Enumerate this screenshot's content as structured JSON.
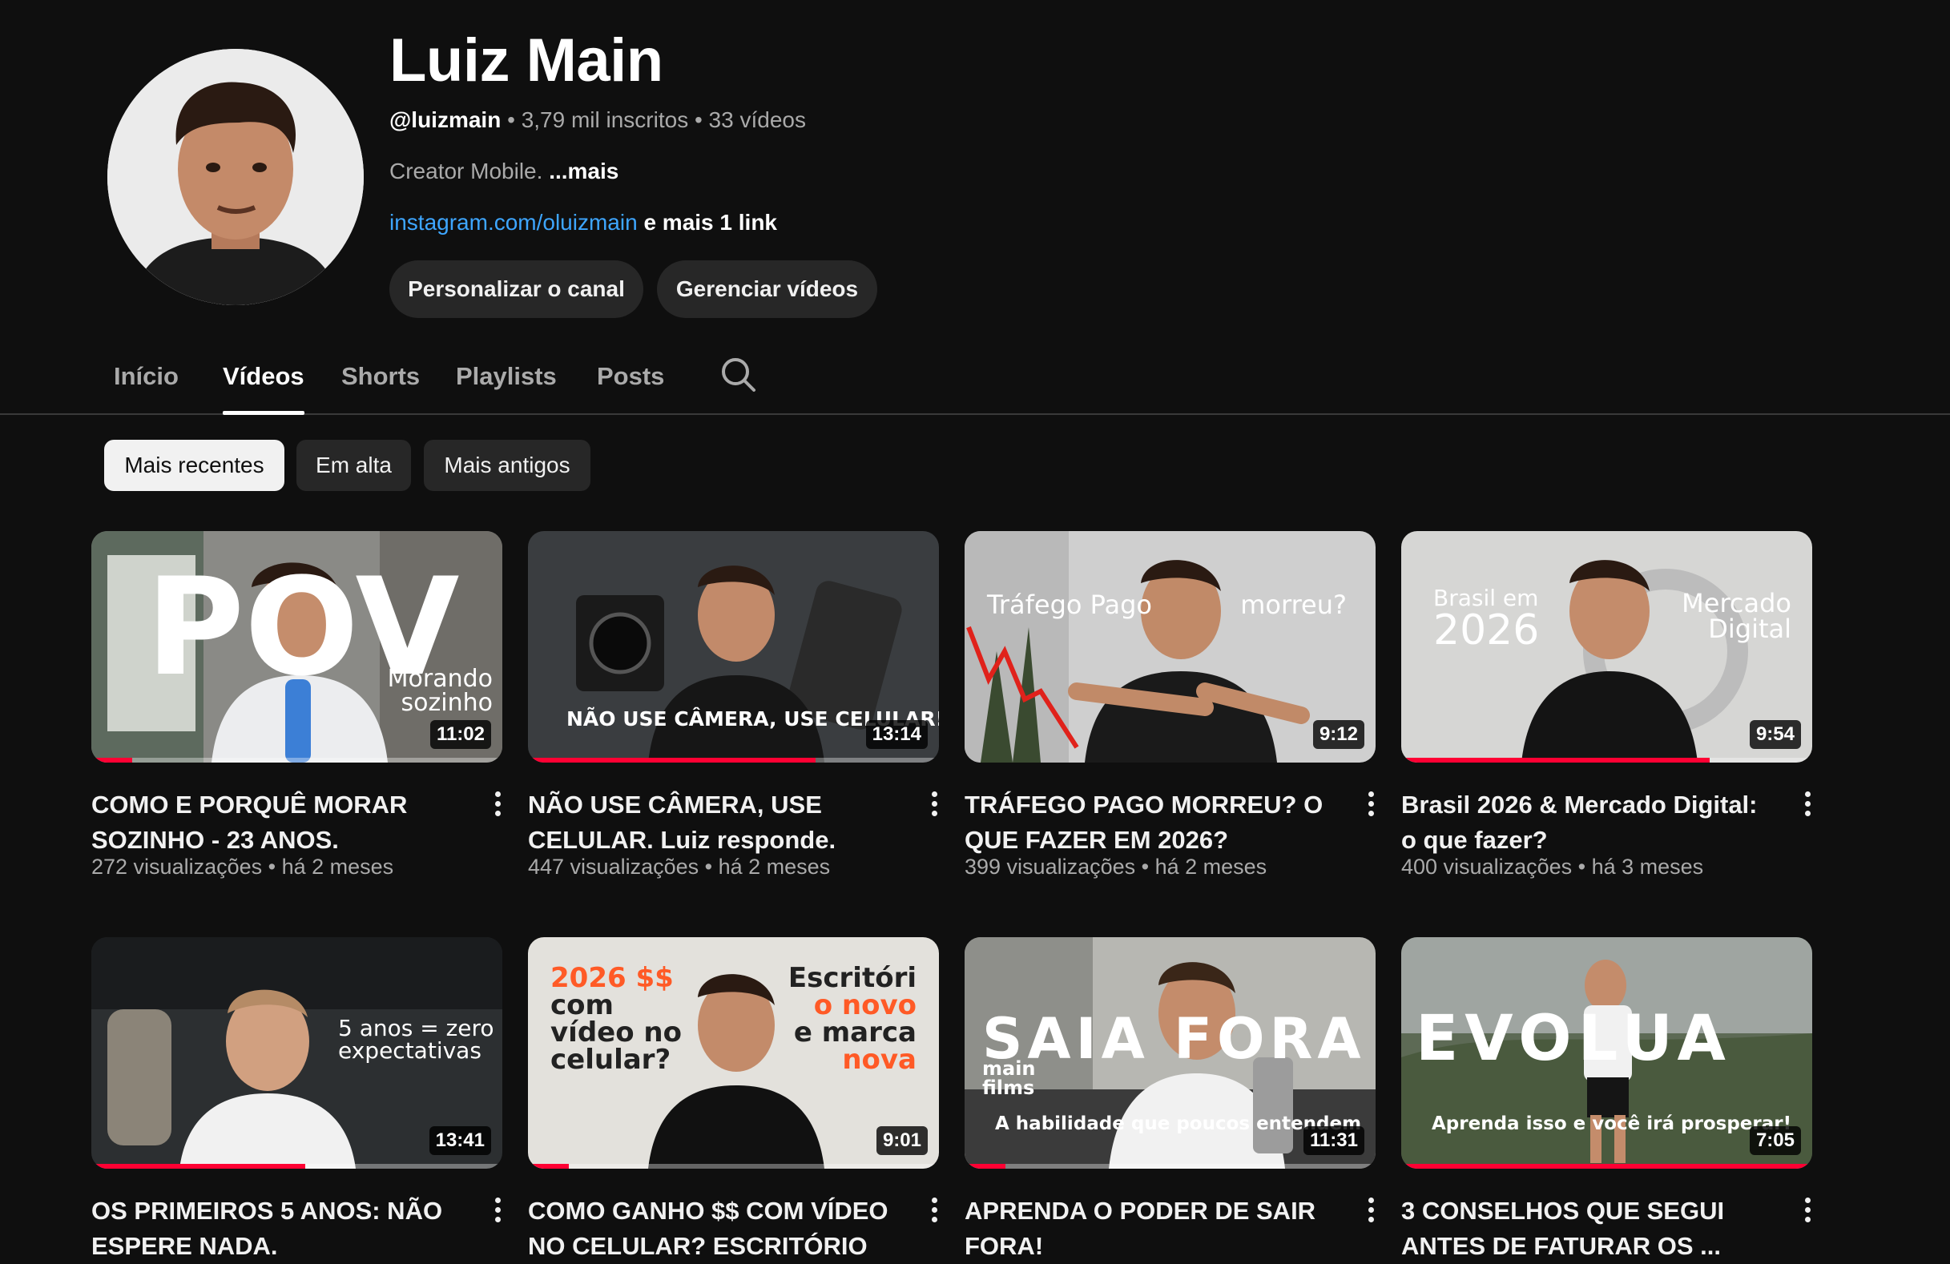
{
  "channel": {
    "name": "Luiz Main",
    "handle": "@luizmain",
    "stats": " • 3,79 mil inscritos • 33 vídeos",
    "description": "Creator Mobile. ",
    "more_label": "...mais",
    "link": "instagram.com/oluizmain",
    "extra_links": " e mais 1 link",
    "customize_label": "Personalizar o canal",
    "manage_label": "Gerenciar vídeos"
  },
  "tabs": [
    {
      "label": "Início"
    },
    {
      "label": "Vídeos"
    },
    {
      "label": "Shorts"
    },
    {
      "label": "Playlists"
    },
    {
      "label": "Posts"
    }
  ],
  "active_tab": "Vídeos",
  "filters": [
    {
      "label": "Mais recentes"
    },
    {
      "label": "Em alta"
    },
    {
      "label": "Mais antigos"
    }
  ],
  "active_filter": "Mais recentes",
  "videos": [
    {
      "title": "COMO E PORQUÊ MORAR SOZINHO - 23 ANOS.",
      "meta": "272 visualizações • há 2 meses",
      "duration": "11:02",
      "progress": 0.1,
      "overlay": {
        "big": "POV",
        "small1": "Morando",
        "small2": "sozinho"
      }
    },
    {
      "title": "NÃO USE CÂMERA, USE CELULAR. Luiz responde.",
      "meta": "447 visualizações • há 2 meses",
      "duration": "13:14",
      "progress": 0.7,
      "overlay": {
        "line": "NÃO USE CÂMERA, USE CELULAR!"
      }
    },
    {
      "title": "TRÁFEGO PAGO MORREU? O QUE FAZER EM 2026?",
      "meta": "399 visualizações • há 2 meses",
      "duration": "9:12",
      "progress": 0.0,
      "overlay": {
        "left": "Tráfego Pago",
        "right": "morreu?"
      }
    },
    {
      "title": "Brasil 2026 & Mercado Digital: o que fazer?",
      "meta": "400 visualizações • há 3 meses",
      "duration": "9:54",
      "progress": 0.75,
      "overlay": {
        "l1": "Brasil em",
        "l2": "2026",
        "r1": "Mercado",
        "r2": "Digital"
      }
    },
    {
      "title": "OS PRIMEIROS 5 ANOS: NÃO ESPERE NADA.",
      "meta": "",
      "duration": "13:41",
      "progress": 0.52,
      "overlay": {
        "l1": "5 anos = zero",
        "l2": "expectativas"
      }
    },
    {
      "title": "COMO GANHO $$ COM VÍDEO NO CELULAR? ESCRITÓRIO ...",
      "meta": "",
      "duration": "9:01",
      "progress": 0.1,
      "overlay": {
        "a1": "2026 $$",
        "a2": "com",
        "a3": "vídeo no",
        "a4": "celular?",
        "b1": "Escritóri",
        "b2": "o novo",
        "b3": "e marca",
        "b4": "nova"
      }
    },
    {
      "title": "APRENDA O PODER DE SAIR FORA!",
      "meta": "",
      "duration": "11:31",
      "progress": 0.1,
      "overlay": {
        "big": "SAIA FORA",
        "brand1": "main",
        "brand2": "films",
        "sub": "A habilidade que poucos entendem"
      }
    },
    {
      "title": "3 CONSELHOS QUE SEGUI ANTES DE FATURAR OS ...",
      "meta": "",
      "duration": "7:05",
      "progress": 1.0,
      "overlay": {
        "big": "EVOLUA",
        "sub": "Aprenda isso e você irá prosperar!"
      }
    }
  ],
  "colors": {
    "accent": "#ff0033",
    "link": "#3ea6ff",
    "background": "#0f0f0f"
  }
}
